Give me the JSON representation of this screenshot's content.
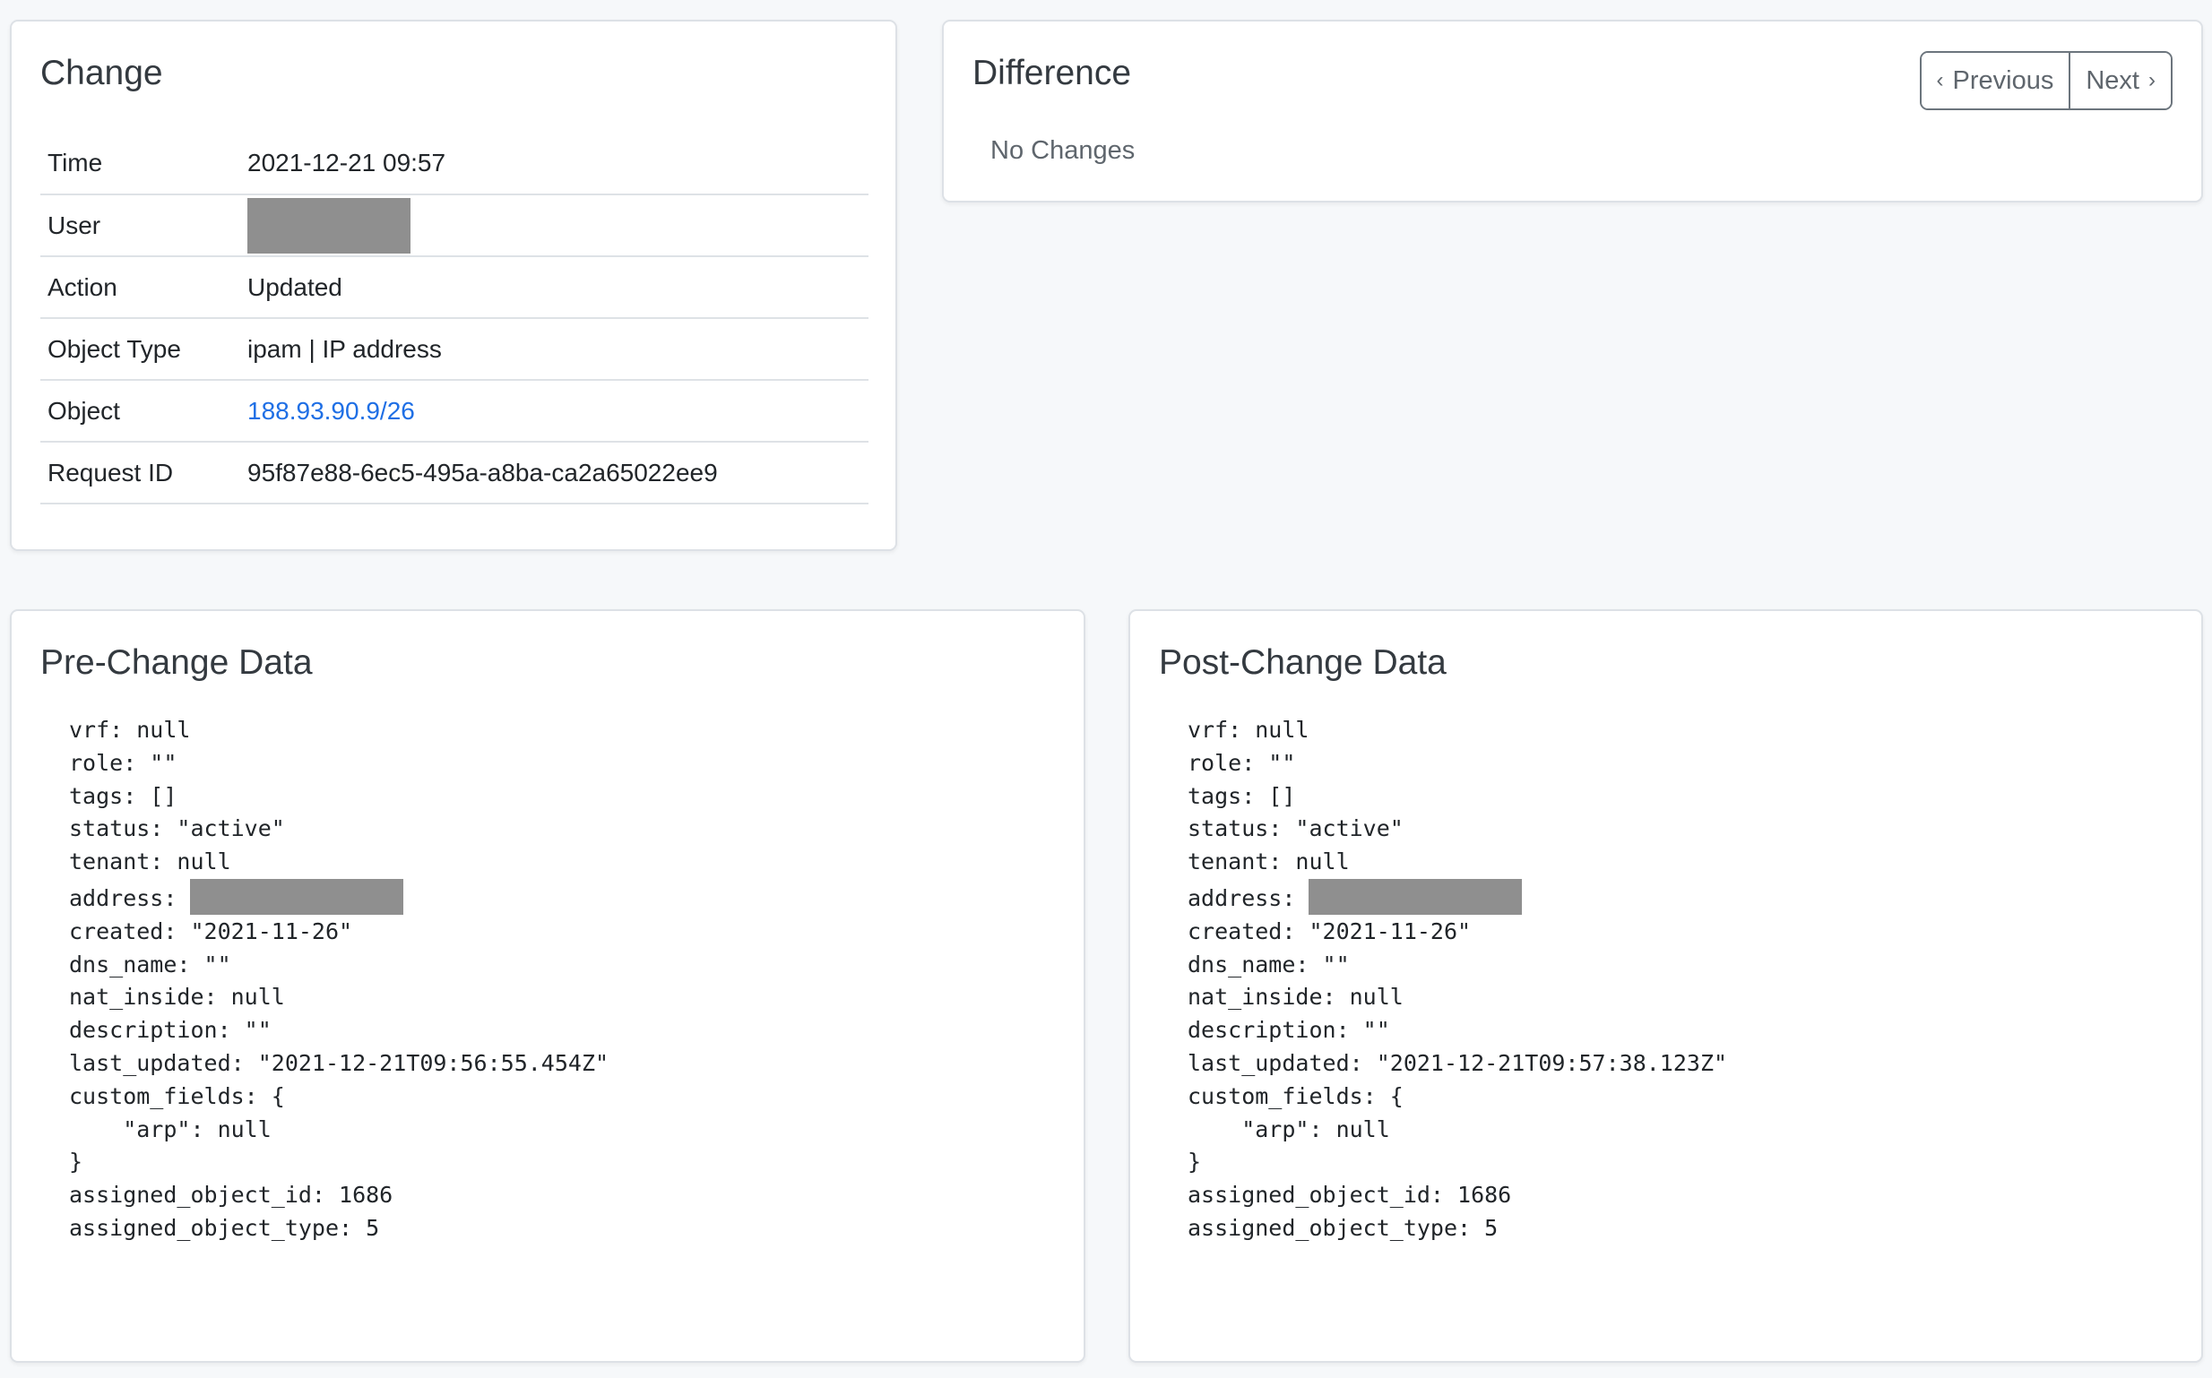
{
  "change": {
    "title": "Change",
    "rows": [
      {
        "key": "Time",
        "value": "2021-12-21 09:57"
      },
      {
        "key": "User",
        "value": null
      },
      {
        "key": "Action",
        "value": "Updated"
      },
      {
        "key": "Object Type",
        "value": "ipam | IP address"
      },
      {
        "key": "Object",
        "value": "188.93.90.9/26"
      },
      {
        "key": "Request ID",
        "value": "95f87e88-6ec5-495a-a8ba-ca2a65022ee9"
      }
    ]
  },
  "difference": {
    "title": "Difference",
    "previous_label": "Previous",
    "next_label": "Next",
    "empty_text": "No Changes"
  },
  "pre_change": {
    "title": "Pre-Change Data",
    "lines": {
      "vrf": "vrf: null",
      "role": "role: \"\"",
      "tags": "tags: []",
      "status": "status: \"active\"",
      "tenant": "tenant: null",
      "address_key": "address: ",
      "created": "created: \"2021-11-26\"",
      "dns_name": "dns_name: \"\"",
      "nat_inside": "nat_inside: null",
      "description": "description: \"\"",
      "last_updated": "last_updated: \"2021-12-21T09:56:55.454Z\"",
      "custom_fields_open": "custom_fields: {",
      "arp": "    \"arp\": null",
      "custom_fields_close": "}",
      "assigned_object_id": "assigned_object_id: 1686",
      "assigned_object_type": "assigned_object_type: 5"
    }
  },
  "post_change": {
    "title": "Post-Change Data",
    "lines": {
      "vrf": "vrf: null",
      "role": "role: \"\"",
      "tags": "tags: []",
      "status": "status: \"active\"",
      "tenant": "tenant: null",
      "address_key": "address: ",
      "created": "created: \"2021-11-26\"",
      "dns_name": "dns_name: \"\"",
      "nat_inside": "nat_inside: null",
      "description": "description: \"\"",
      "last_updated": "last_updated: \"2021-12-21T09:57:38.123Z\"",
      "custom_fields_open": "custom_fields: {",
      "arp": "    \"arp\": null",
      "custom_fields_close": "}",
      "assigned_object_id": "assigned_object_id: 1686",
      "assigned_object_type": "assigned_object_type: 5"
    }
  },
  "colors": {
    "link": "#1f6fe5",
    "redaction": "#8f8f8f",
    "page_background": "#f6f8fa"
  }
}
